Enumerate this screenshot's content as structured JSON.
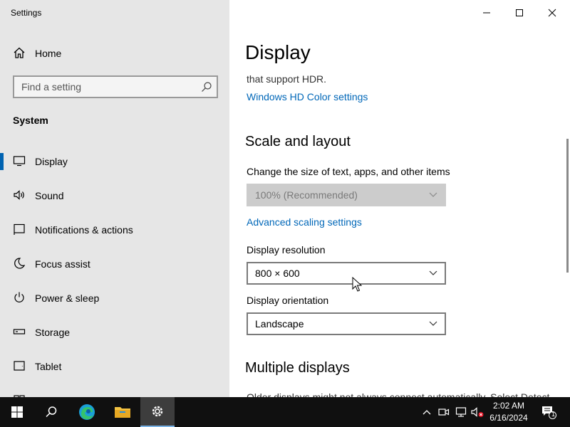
{
  "window": {
    "app_title": "Settings",
    "controls": {
      "minimize": "minimize",
      "maximize": "maximize",
      "close": "close"
    }
  },
  "sidebar": {
    "home_label": "Home",
    "search": {
      "placeholder": "Find a setting"
    },
    "section_title": "System",
    "items": [
      {
        "label": "Display",
        "icon": "monitor-icon",
        "selected": true
      },
      {
        "label": "Sound",
        "icon": "speaker-icon",
        "selected": false
      },
      {
        "label": "Notifications & actions",
        "icon": "notifications-icon",
        "selected": false
      },
      {
        "label": "Focus assist",
        "icon": "moon-icon",
        "selected": false
      },
      {
        "label": "Power & sleep",
        "icon": "power-icon",
        "selected": false
      },
      {
        "label": "Storage",
        "icon": "storage-icon",
        "selected": false
      },
      {
        "label": "Tablet",
        "icon": "tablet-icon",
        "selected": false
      }
    ],
    "accent_color": "#0063b1"
  },
  "content": {
    "title": "Display",
    "hdr_text_tail": "that support HDR.",
    "hdr_link": "Windows HD Color settings",
    "scale_heading": "Scale and layout",
    "scale_label": "Change the size of text, apps, and other items",
    "scale_value": "100% (Recommended)",
    "scale_disabled": true,
    "advanced_scaling_link": "Advanced scaling settings",
    "resolution_label": "Display resolution",
    "resolution_value": "800 × 600",
    "orientation_label": "Display orientation",
    "orientation_value": "Landscape",
    "multiple_heading": "Multiple displays",
    "multiple_text_partial": "Older displays might not always connect automatically. Select Detect",
    "link_color": "#0067b8"
  },
  "taskbar": {
    "items": [
      {
        "name": "start",
        "icon": "windows-logo-icon"
      },
      {
        "name": "search",
        "icon": "search-icon"
      },
      {
        "name": "edge",
        "icon": "edge-icon"
      },
      {
        "name": "file-explorer",
        "icon": "folder-icon"
      },
      {
        "name": "settings",
        "icon": "gear-icon",
        "active": true
      }
    ],
    "tray_icons": [
      "chevron-up-icon",
      "meet-now-icon",
      "network-icon",
      "volume-muted-icon"
    ],
    "time": "2:02 AM",
    "date": "6/16/2024",
    "notification_count": "1"
  }
}
